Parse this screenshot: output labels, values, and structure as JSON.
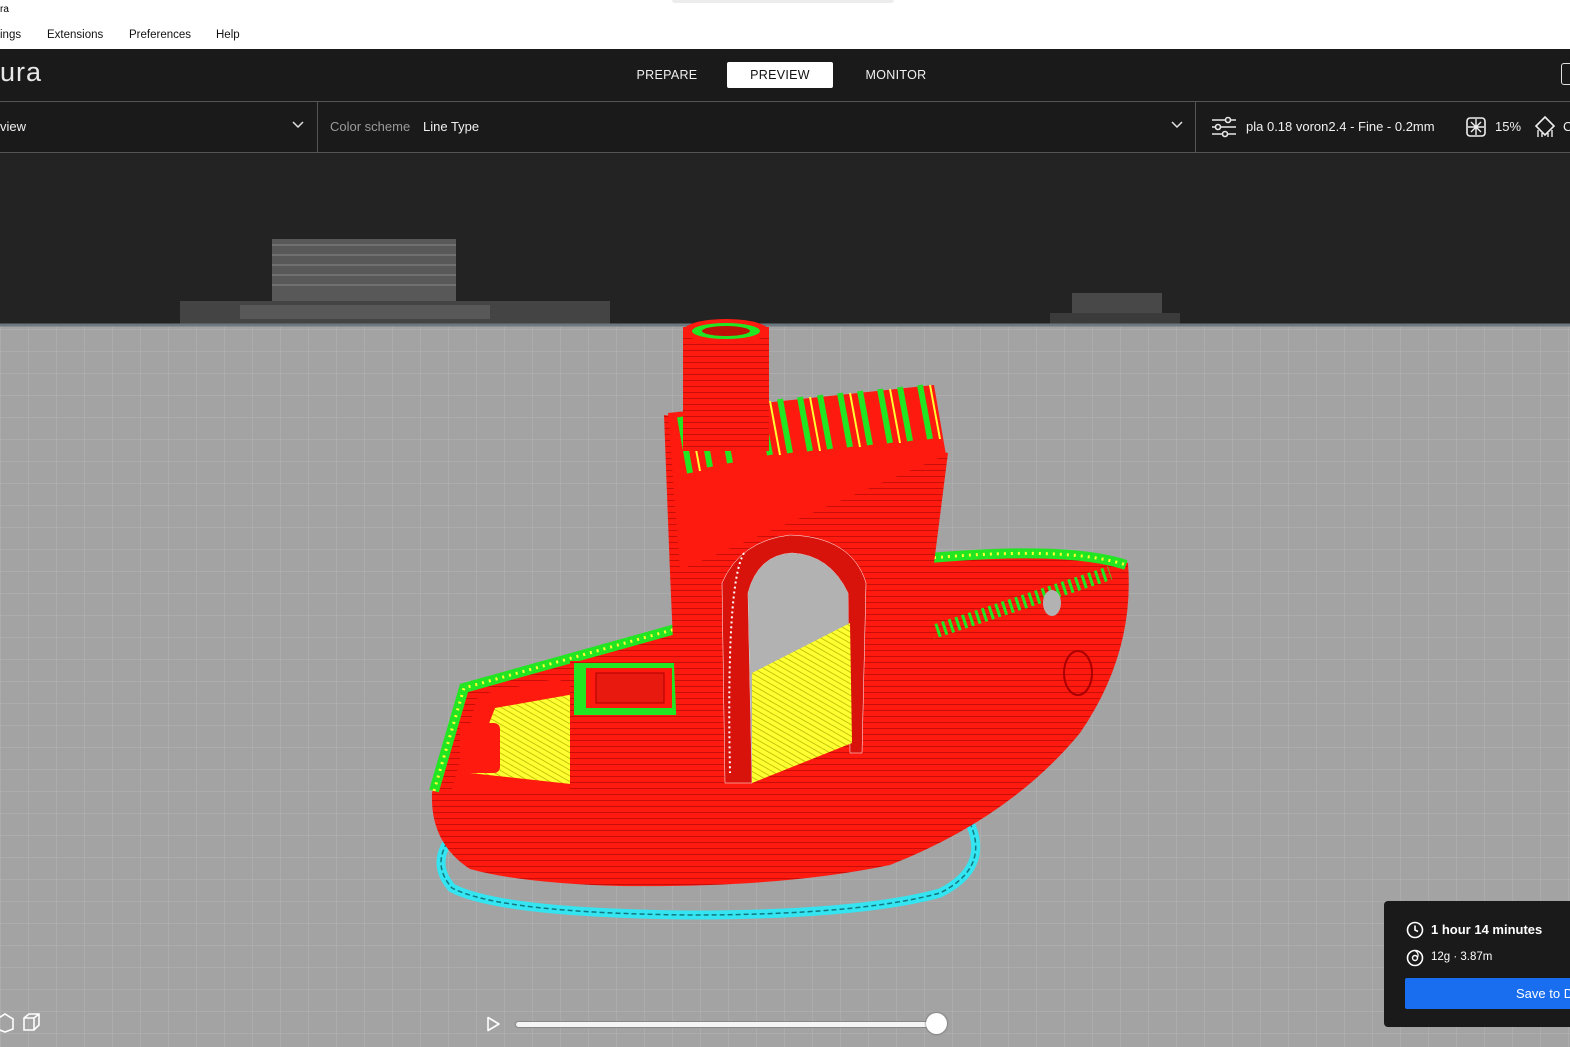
{
  "window": {
    "title": "ra"
  },
  "menu": {
    "items": [
      "ings",
      "Extensions",
      "Preferences",
      "Help"
    ]
  },
  "app": {
    "logo": "ura"
  },
  "stages": {
    "prepare": "PREPARE",
    "preview": "PREVIEW",
    "monitor": "MONITOR",
    "active": "PREVIEW"
  },
  "toolbar": {
    "view_type": "view",
    "color_scheme_label": "Color scheme",
    "color_scheme_value": "Line Type",
    "print_profile": "pla 0.18 voron2.4 - Fine - 0.2mm",
    "infill": "15%",
    "support_truncated": "C"
  },
  "print_info": {
    "time": "1 hour 14 minutes",
    "material": "12g · 3.87m",
    "save_button": "Save to D"
  },
  "layer_slider": {
    "value_fraction": 1.0
  },
  "colors": {
    "ui_dark": "#1a1a1a",
    "accent_blue": "#196ef0",
    "wall_outer": "#ff1a10",
    "wall_inner": "#22e622",
    "skin": "#ffff32",
    "skirt": "#34e4f0",
    "build_plate": "#a3a3a3"
  }
}
